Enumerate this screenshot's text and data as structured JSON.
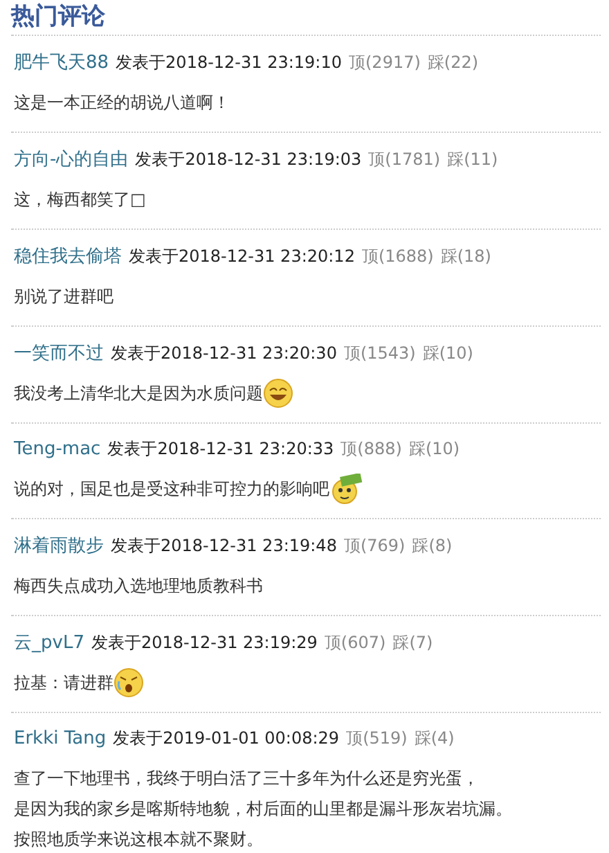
{
  "title": "热门评论",
  "comments": [
    {
      "author": "肥牛飞天88",
      "posted": "发表于2018-12-31  23:19:10",
      "up": "顶(2917)",
      "down": "踩(22)",
      "lines": [
        "这是一本正经的胡说八道啊！"
      ]
    },
    {
      "author": "方向-心的自由",
      "posted": "发表于2018-12-31  23:19:03",
      "up": "顶(1781)",
      "down": "踩(11)",
      "lines": [
        "这，梅西都笑了□"
      ]
    },
    {
      "author": "稳住我去偷塔",
      "posted": "发表于2018-12-31  23:20:12",
      "up": "顶(1688)",
      "down": "踩(18)",
      "lines": [
        "别说了进群吧"
      ]
    },
    {
      "author": "一笑而不过",
      "posted": "发表于2018-12-31  23:20:30",
      "up": "顶(1543)",
      "down": "踩(10)",
      "lines": [
        "我没考上清华北大是因为水质问题"
      ],
      "emoticon": {
        "kind": "laugh"
      }
    },
    {
      "author": "Teng-mac",
      "posted": "发表于2018-12-31  23:20:33",
      "up": "顶(888)",
      "down": "踩(10)",
      "lines": [
        "说的对，国足也是受这种非可控力的影响吧"
      ],
      "emoticon": {
        "kind": "money"
      }
    },
    {
      "author": "淋着雨散步",
      "posted": "发表于2018-12-31  23:19:48",
      "up": "顶(769)",
      "down": "踩(8)",
      "lines": [
        "梅西失点成功入选地理地质教科书"
      ]
    },
    {
      "author": "云_pvL7",
      "posted": "发表于2018-12-31  23:19:29",
      "up": "顶(607)",
      "down": "踩(7)",
      "lines": [
        "拉基：请进群"
      ],
      "emoticon": {
        "kind": "cry"
      }
    },
    {
      "author": "Erkki Tang",
      "posted": "发表于2019-01-01  00:08:29",
      "up": "顶(519)",
      "down": "踩(4)",
      "lines": [
        "查了一下地理书，我终于明白活了三十多年为什么还是穷光蛋，",
        "是因为我的家乡是喀斯特地貌，村后面的山里都是漏斗形灰岩坑漏。",
        "按照地质学来说这根本就不聚财。"
      ]
    }
  ]
}
